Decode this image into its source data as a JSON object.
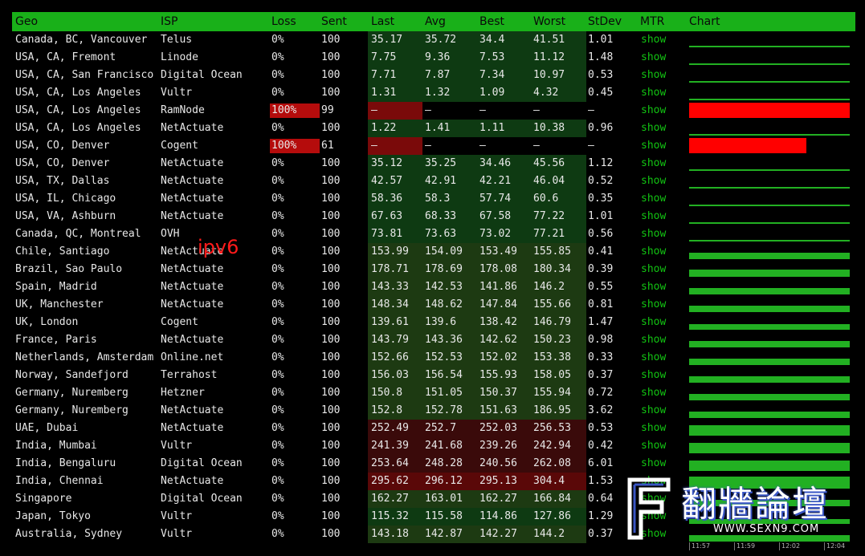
{
  "header": {
    "geo": "Geo",
    "isp": "ISP",
    "loss": "Loss",
    "sent": "Sent",
    "last": "Last",
    "avg": "Avg",
    "best": "Best",
    "worst": "Worst",
    "stdev": "StDev",
    "mtr": "MTR",
    "chart": "Chart"
  },
  "mtr_link_label": "show",
  "overlay_label": "ipv6",
  "timeline_ticks": [
    "11:57",
    "11:59",
    "12:02",
    "12:04"
  ],
  "watermark": {
    "title": "翻牆論壇",
    "url": "WWW.SEXN9.COM"
  },
  "colors": {
    "header_green": "#19b019",
    "link_green": "#12c412",
    "fast_bg": "#0e3a12",
    "medium_bg": "#1d3a12",
    "slow_bg": "#3a0a0a",
    "loss_red": "#b50c0c"
  },
  "rows": [
    {
      "geo": "Canada, BC, Vancouver",
      "isp": "Telus",
      "loss": "0%",
      "sent": "100",
      "last": "35.17",
      "avg": "35.72",
      "best": "34.4",
      "worst": "41.51",
      "stdev": "1.01",
      "band": "fast",
      "chart_fill": 0.05
    },
    {
      "geo": "USA, CA, Fremont",
      "isp": "Linode",
      "loss": "0%",
      "sent": "100",
      "last": "7.75",
      "avg": "9.36",
      "best": "7.53",
      "worst": "11.12",
      "stdev": "1.48",
      "band": "fast",
      "chart_fill": 0.02
    },
    {
      "geo": "USA, CA, San Francisco",
      "isp": "Digital Ocean",
      "loss": "0%",
      "sent": "100",
      "last": "7.71",
      "avg": "7.87",
      "best": "7.34",
      "worst": "10.97",
      "stdev": "0.53",
      "band": "fast",
      "chart_fill": 0.02
    },
    {
      "geo": "USA, CA, Los Angeles",
      "isp": "Vultr",
      "loss": "0%",
      "sent": "100",
      "last": "1.31",
      "avg": "1.32",
      "best": "1.09",
      "worst": "4.32",
      "stdev": "0.45",
      "band": "fast",
      "chart_fill": 0.01
    },
    {
      "geo": "USA, CA, Los Angeles",
      "isp": "RamNode",
      "loss": "100%",
      "sent": "99",
      "last": "–",
      "avg": "–",
      "best": "–",
      "worst": "–",
      "stdev": "–",
      "band": "dead",
      "chart_fill": 1.0
    },
    {
      "geo": "USA, CA, Los Angeles",
      "isp": "NetActuate",
      "loss": "0%",
      "sent": "100",
      "last": "1.22",
      "avg": "1.41",
      "best": "1.11",
      "worst": "10.38",
      "stdev": "0.96",
      "band": "fast",
      "chart_fill": 0.01
    },
    {
      "geo": "USA, CO, Denver",
      "isp": "Cogent",
      "loss": "100%",
      "sent": "61",
      "last": "–",
      "avg": "–",
      "best": "–",
      "worst": "–",
      "stdev": "–",
      "band": "dead",
      "chart_fill": 0.73
    },
    {
      "geo": "USA, CO, Denver",
      "isp": "NetActuate",
      "loss": "0%",
      "sent": "100",
      "last": "35.12",
      "avg": "35.25",
      "best": "34.46",
      "worst": "45.56",
      "stdev": "1.12",
      "band": "fast",
      "chart_fill": 0.05
    },
    {
      "geo": "USA, TX, Dallas",
      "isp": "NetActuate",
      "loss": "0%",
      "sent": "100",
      "last": "42.57",
      "avg": "42.91",
      "best": "42.21",
      "worst": "46.04",
      "stdev": "0.52",
      "band": "fast",
      "chart_fill": 0.06
    },
    {
      "geo": "USA, IL, Chicago",
      "isp": "NetActuate",
      "loss": "0%",
      "sent": "100",
      "last": "58.36",
      "avg": "58.3",
      "best": "57.74",
      "worst": "60.6",
      "stdev": "0.35",
      "band": "fast",
      "chart_fill": 0.08
    },
    {
      "geo": "USA, VA, Ashburn",
      "isp": "NetActuate",
      "loss": "0%",
      "sent": "100",
      "last": "67.63",
      "avg": "68.33",
      "best": "67.58",
      "worst": "77.22",
      "stdev": "1.01",
      "band": "fast",
      "chart_fill": 0.09
    },
    {
      "geo": "Canada, QC, Montreal",
      "isp": "OVH",
      "loss": "0%",
      "sent": "100",
      "last": "73.81",
      "avg": "73.63",
      "best": "73.02",
      "worst": "77.21",
      "stdev": "0.56",
      "band": "fast",
      "chart_fill": 0.1
    },
    {
      "geo": "Chile, Santiago",
      "isp": "NetActuate",
      "loss": "0%",
      "sent": "100",
      "last": "153.99",
      "avg": "154.09",
      "best": "153.49",
      "worst": "155.85",
      "stdev": "0.41",
      "band": "medium",
      "chart_fill": 0.4
    },
    {
      "geo": "Brazil, Sao Paulo",
      "isp": "NetActuate",
      "loss": "0%",
      "sent": "100",
      "last": "178.71",
      "avg": "178.69",
      "best": "178.08",
      "worst": "180.34",
      "stdev": "0.39",
      "band": "medium",
      "chart_fill": 0.45
    },
    {
      "geo": "Spain, Madrid",
      "isp": "NetActuate",
      "loss": "0%",
      "sent": "100",
      "last": "143.33",
      "avg": "142.53",
      "best": "141.86",
      "worst": "146.2",
      "stdev": "0.55",
      "band": "medium",
      "chart_fill": 0.38
    },
    {
      "geo": "UK, Manchester",
      "isp": "NetActuate",
      "loss": "0%",
      "sent": "100",
      "last": "148.34",
      "avg": "148.62",
      "best": "147.84",
      "worst": "155.66",
      "stdev": "0.81",
      "band": "medium",
      "chart_fill": 0.39
    },
    {
      "geo": "UK, London",
      "isp": "Cogent",
      "loss": "0%",
      "sent": "100",
      "last": "139.61",
      "avg": "139.6",
      "best": "138.42",
      "worst": "146.79",
      "stdev": "1.47",
      "band": "medium",
      "chart_fill": 0.37
    },
    {
      "geo": "France, Paris",
      "isp": "NetActuate",
      "loss": "0%",
      "sent": "100",
      "last": "143.79",
      "avg": "143.36",
      "best": "142.62",
      "worst": "150.23",
      "stdev": "0.98",
      "band": "medium",
      "chart_fill": 0.38
    },
    {
      "geo": "Netherlands, Amsterdam",
      "isp": "Online.net",
      "loss": "0%",
      "sent": "100",
      "last": "152.66",
      "avg": "152.53",
      "best": "152.02",
      "worst": "153.38",
      "stdev": "0.33",
      "band": "medium",
      "chart_fill": 0.4
    },
    {
      "geo": "Norway, Sandefjord",
      "isp": "Terrahost",
      "loss": "0%",
      "sent": "100",
      "last": "156.03",
      "avg": "156.54",
      "best": "155.93",
      "worst": "158.05",
      "stdev": "0.37",
      "band": "medium",
      "chart_fill": 0.41
    },
    {
      "geo": "Germany, Nuremberg",
      "isp": "Hetzner",
      "loss": "0%",
      "sent": "100",
      "last": "150.8",
      "avg": "151.05",
      "best": "150.37",
      "worst": "155.94",
      "stdev": "0.72",
      "band": "medium",
      "chart_fill": 0.4
    },
    {
      "geo": "Germany, Nuremberg",
      "isp": "NetActuate",
      "loss": "0%",
      "sent": "100",
      "last": "152.8",
      "avg": "152.78",
      "best": "151.63",
      "worst": "186.95",
      "stdev": "3.62",
      "band": "medium",
      "chart_fill": 0.4
    },
    {
      "geo": "UAE, Dubai",
      "isp": "NetActuate",
      "loss": "0%",
      "sent": "100",
      "last": "252.49",
      "avg": "252.7",
      "best": "252.03",
      "worst": "256.53",
      "stdev": "0.53",
      "band": "slow",
      "chart_fill": 0.65
    },
    {
      "geo": "India, Mumbai",
      "isp": "Vultr",
      "loss": "0%",
      "sent": "100",
      "last": "241.39",
      "avg": "241.68",
      "best": "239.26",
      "worst": "242.94",
      "stdev": "0.42",
      "band": "slow",
      "chart_fill": 0.63
    },
    {
      "geo": "India, Bengaluru",
      "isp": "Digital Ocean",
      "loss": "0%",
      "sent": "100",
      "last": "253.64",
      "avg": "248.28",
      "best": "240.56",
      "worst": "262.08",
      "stdev": "6.01",
      "band": "slow",
      "chart_fill": 0.65
    },
    {
      "geo": "India, Chennai",
      "isp": "NetActuate",
      "loss": "0%",
      "sent": "100",
      "last": "295.62",
      "avg": "296.12",
      "best": "295.13",
      "worst": "304.4",
      "stdev": "1.53",
      "band": "slowest",
      "chart_fill": 0.75
    },
    {
      "geo": "Singapore",
      "isp": "Digital Ocean",
      "loss": "0%",
      "sent": "100",
      "last": "162.27",
      "avg": "163.01",
      "best": "162.27",
      "worst": "166.84",
      "stdev": "0.64",
      "band": "medium",
      "chart_fill": 0.42
    },
    {
      "geo": "Japan, Tokyo",
      "isp": "Vultr",
      "loss": "0%",
      "sent": "100",
      "last": "115.32",
      "avg": "115.58",
      "best": "114.86",
      "worst": "127.86",
      "stdev": "1.29",
      "band": "fast",
      "chart_fill": 0.3
    },
    {
      "geo": "Australia, Sydney",
      "isp": "Vultr",
      "loss": "0%",
      "sent": "100",
      "last": "143.18",
      "avg": "142.87",
      "best": "142.27",
      "worst": "144.2",
      "stdev": "0.37",
      "band": "medium",
      "chart_fill": 0.38
    }
  ]
}
